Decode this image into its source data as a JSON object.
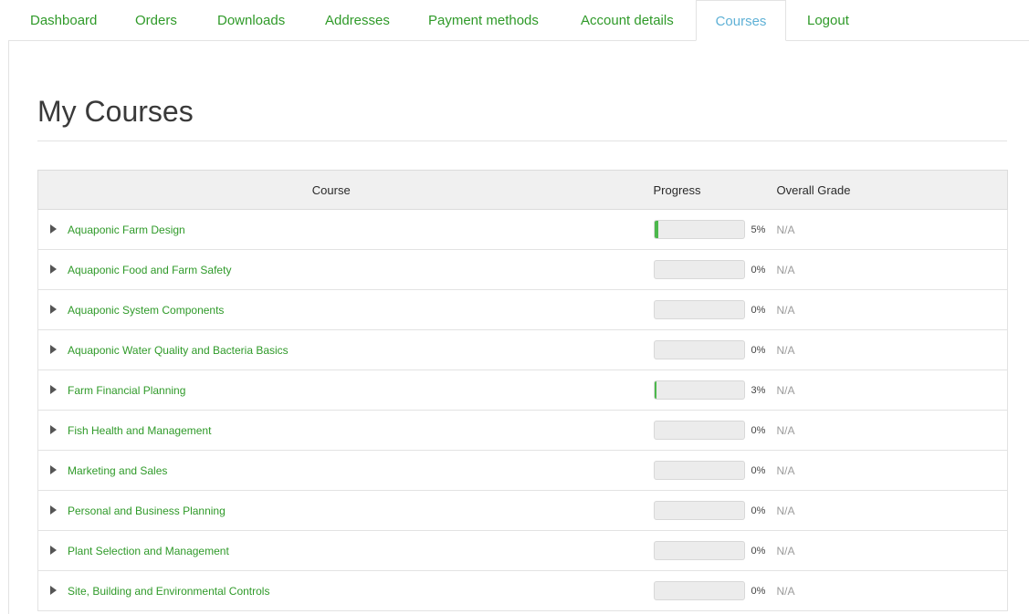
{
  "tabs": [
    {
      "label": "Dashboard",
      "active": false
    },
    {
      "label": "Orders",
      "active": false
    },
    {
      "label": "Downloads",
      "active": false
    },
    {
      "label": "Addresses",
      "active": false
    },
    {
      "label": "Payment methods",
      "active": false
    },
    {
      "label": "Account details",
      "active": false
    },
    {
      "label": "Courses",
      "active": true
    },
    {
      "label": "Logout",
      "active": false
    }
  ],
  "page_title": "My Courses",
  "table": {
    "headers": {
      "course": "Course",
      "progress": "Progress",
      "grade": "Overall Grade"
    },
    "rows": [
      {
        "course": "Aquaponic Farm Design",
        "progress": 5,
        "progress_text": "5%",
        "grade": "N/A"
      },
      {
        "course": "Aquaponic Food and Farm Safety",
        "progress": 0,
        "progress_text": "0%",
        "grade": "N/A"
      },
      {
        "course": "Aquaponic System Components",
        "progress": 0,
        "progress_text": "0%",
        "grade": "N/A"
      },
      {
        "course": "Aquaponic Water Quality and Bacteria Basics",
        "progress": 0,
        "progress_text": "0%",
        "grade": "N/A"
      },
      {
        "course": "Farm Financial Planning",
        "progress": 3,
        "progress_text": "3%",
        "grade": "N/A"
      },
      {
        "course": "Fish Health and Management",
        "progress": 0,
        "progress_text": "0%",
        "grade": "N/A"
      },
      {
        "course": "Marketing and Sales",
        "progress": 0,
        "progress_text": "0%",
        "grade": "N/A"
      },
      {
        "course": "Personal and Business Planning",
        "progress": 0,
        "progress_text": "0%",
        "grade": "N/A"
      },
      {
        "course": "Plant Selection and Management",
        "progress": 0,
        "progress_text": "0%",
        "grade": "N/A"
      },
      {
        "course": "Site, Building and Environmental Controls",
        "progress": 0,
        "progress_text": "0%",
        "grade": "N/A"
      }
    ]
  },
  "colors": {
    "link_green": "#2f9a29",
    "active_tab_blue": "#5fb1d6",
    "progress_fill": "#4cb84c",
    "header_bg": "#f0f0f0"
  },
  "icons": {
    "row_expand": "triangle-right-icon"
  }
}
